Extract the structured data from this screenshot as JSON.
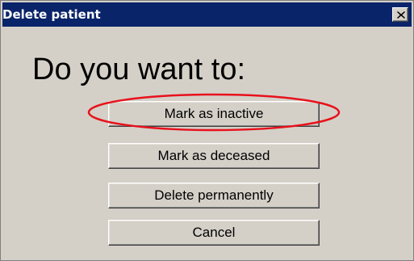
{
  "window": {
    "title": "Delete patient",
    "close_icon": "close-icon"
  },
  "dialog": {
    "heading": "Do you want to:",
    "buttons": {
      "mark_inactive": "Mark as inactive",
      "mark_deceased": "Mark as deceased",
      "delete_permanently": "Delete permanently",
      "cancel": "Cancel"
    }
  },
  "colors": {
    "titlebar": "#0a246a",
    "dialog_background": "#d4d0c8",
    "annotation_ellipse": "#e8111b"
  }
}
